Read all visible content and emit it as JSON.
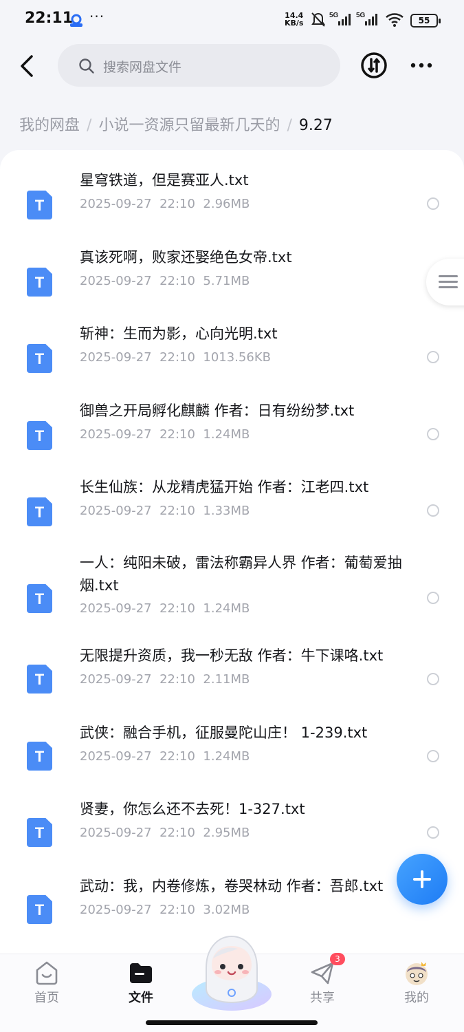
{
  "status_bar": {
    "time": "22:11",
    "dots": "···",
    "speed_value": "14.4",
    "speed_unit": "KB/s",
    "signal_label_1": "5G",
    "signal_label_2": "5G",
    "battery": "55"
  },
  "search": {
    "placeholder": "搜索网盘文件"
  },
  "breadcrumb": {
    "root": "我的网盘",
    "separator": "/",
    "folder": "小说一资源只留最新几天的",
    "current": "9.27"
  },
  "files": [
    {
      "name": "星穹铁道，但是赛亚人.txt",
      "date": "2025-09-27",
      "time": "22:10",
      "size": "2.96MB"
    },
    {
      "name": "真该死啊，败家还娶绝色女帝.txt",
      "date": "2025-09-27",
      "time": "22:10",
      "size": "5.71MB"
    },
    {
      "name": "斩神：生而为影，心向光明.txt",
      "date": "2025-09-27",
      "time": "22:10",
      "size": "1013.56KB"
    },
    {
      "name": "御兽之开局孵化麒麟 作者：日有纷纷梦.txt",
      "date": "2025-09-27",
      "time": "22:10",
      "size": "1.24MB"
    },
    {
      "name": "长生仙族：从龙精虎猛开始 作者：江老四.txt",
      "date": "2025-09-27",
      "time": "22:10",
      "size": "1.33MB"
    },
    {
      "name": "一人：纯阳未破，雷法称霸异人界 作者：葡萄爱抽烟.txt",
      "date": "2025-09-27",
      "time": "22:10",
      "size": "1.24MB"
    },
    {
      "name": "无限提升资质，我一秒无敌 作者：牛下课咯.txt",
      "date": "2025-09-27",
      "time": "22:10",
      "size": "2.11MB"
    },
    {
      "name": "武侠：融合手机，征服曼陀山庄！ 1-239.txt",
      "date": "2025-09-27",
      "time": "22:10",
      "size": "1.24MB"
    },
    {
      "name": "贤妻，你怎么还不去死！1-327.txt",
      "date": "2025-09-27",
      "time": "22:10",
      "size": "2.95MB"
    },
    {
      "name": "武动：我，内卷修炼，卷哭林动 作者：吾郎.txt",
      "date": "2025-09-27",
      "time": "22:10",
      "size": "3.02MB"
    }
  ],
  "nav": {
    "home": "首页",
    "files": "文件",
    "share": "共享",
    "share_badge": "3",
    "mine": "我的"
  },
  "colors": {
    "accent": "#1e7cf5",
    "file_icon": "#4b8cf6",
    "badge": "#ff4d5e"
  }
}
